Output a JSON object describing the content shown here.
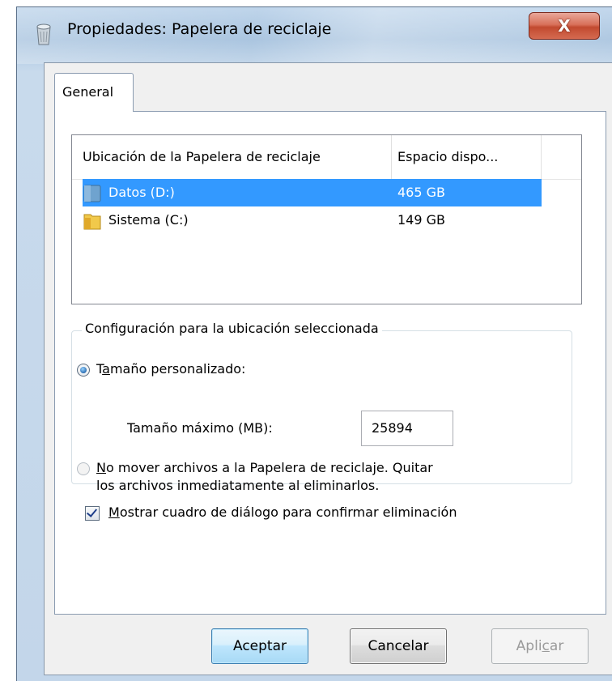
{
  "window": {
    "title": "Propiedades: Papelera de reciclaje",
    "close_glyph": "X",
    "title_icon": "recycle-bin-icon"
  },
  "tabs": [
    {
      "label": "General",
      "active": true
    }
  ],
  "location_list": {
    "columns": [
      "Ubicación de la Papelera de reciclaje",
      "Espacio dispo..."
    ],
    "rows": [
      {
        "name": "Datos (D:)",
        "space": "465 GB",
        "icon": "drive-folder-icon",
        "selected": true
      },
      {
        "name": "Sistema (C:)",
        "space": "149 GB",
        "icon": "folder-icon",
        "selected": false
      }
    ]
  },
  "settings": {
    "group_label": "Configuración para la ubicación seleccionada",
    "custom_size": {
      "label_prefix": "T",
      "label_underlined": "a",
      "label_rest": "maño personalizado:",
      "selected": true
    },
    "max_size": {
      "label": "Tamaño máximo (MB):",
      "value": "25894"
    },
    "no_move": {
      "line1_underlined": "N",
      "line1_rest": "o mover archivos a la Papelera de reciclaje. Quitar",
      "line2": "los archivos inmediatamente al eliminarlos.",
      "selected": false
    }
  },
  "confirm_dialog": {
    "underlined": "M",
    "rest": "ostrar cuadro de diálogo para confirmar eliminación",
    "checked": true
  },
  "buttons": {
    "ok": "Aceptar",
    "cancel": "Cancelar",
    "apply_prefix": "Apli",
    "apply_underlined": "c",
    "apply_rest": "ar"
  },
  "colors": {
    "selection": "#3399ff",
    "close_button": "#c24a30",
    "default_button_border": "#3c7fb1"
  }
}
